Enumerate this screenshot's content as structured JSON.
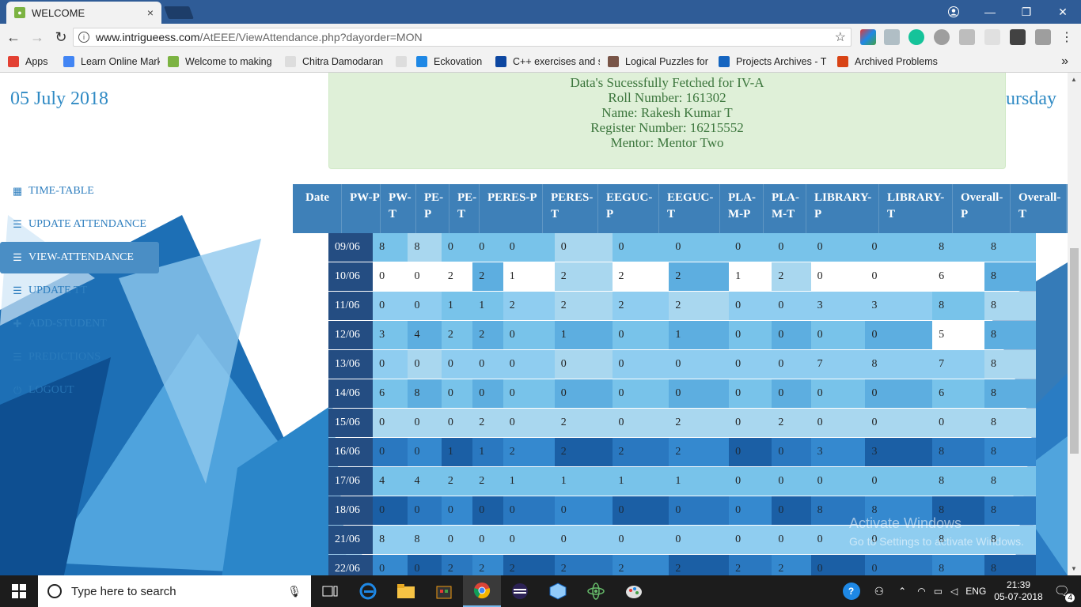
{
  "browser": {
    "tab_title": "WELCOME",
    "tab_close": "×",
    "url_host": "www.intrigueess.com",
    "url_path": "/AtEEE/ViewAttendance.php?dayorder=MON",
    "bookmarks": [
      {
        "label": "Apps",
        "color": "#e34133",
        "icon": "apps-grid-icon"
      },
      {
        "label": "Learn Online Market",
        "color": "#4285f4",
        "icon": "google-icon"
      },
      {
        "label": "Welcome to making",
        "color": "#7cb342",
        "icon": "leaf-icon"
      },
      {
        "label": "Chitra Damodaran",
        "color": "#dddddd",
        "icon": "page-icon"
      },
      {
        "label": "",
        "color": "#dddddd",
        "icon": "page-icon"
      },
      {
        "label": "Eckovation",
        "color": "#1e88e5",
        "icon": "eckovation-icon"
      },
      {
        "label": "C++ exercises and s",
        "color": "#0d47a1",
        "icon": "cpp-icon"
      },
      {
        "label": "Logical Puzzles for In",
        "color": "#795548",
        "icon": "puzzle-icon"
      },
      {
        "label": "Projects Archives - T",
        "color": "#1565c0",
        "icon": "projects-icon"
      },
      {
        "label": "Archived Problems -",
        "color": "#d84315",
        "icon": "archive-icon"
      }
    ],
    "bookmarks_more": "»"
  },
  "page": {
    "date_left": "05 July 2018",
    "day_right": "ursday",
    "alert_lines": [
      "Data's Sucessfully Fetched for IV-A",
      "Roll Number: 161302",
      "Name: Rakesh Kumar T",
      "Register Number: 16215552",
      "Mentor: Mentor Two"
    ],
    "menu": [
      {
        "label": "TIME-TABLE",
        "icon": "calendar-icon",
        "glyph": "▦",
        "active": false
      },
      {
        "label": "UPDATE ATTENDANCE",
        "icon": "list-icon",
        "glyph": "☰",
        "active": false
      },
      {
        "label": "VIEW-ATTENDANCE",
        "icon": "list-icon",
        "glyph": "☰",
        "active": true
      },
      {
        "label": "UPDATE TT",
        "icon": "list-icon",
        "glyph": "☰",
        "active": false
      },
      {
        "label": "ADD-STUDENT",
        "icon": "plus-icon",
        "glyph": "✚",
        "active": false
      },
      {
        "label": "PREDICTIONS",
        "icon": "list-icon",
        "glyph": "☰",
        "active": false
      },
      {
        "label": "LOGOUT",
        "icon": "power-icon",
        "glyph": "⏻",
        "active": false
      }
    ],
    "table": {
      "headers": [
        "Date",
        "PW-P",
        "PW-T",
        "PE-P",
        "PE-T",
        "PERES-P",
        "PERES-T",
        "EEGUC-P",
        "EEGUC-T",
        "PLA-M-P",
        "PLA-M-T",
        "LIBRARY-P",
        "LIBRARY-T",
        "Overall-P",
        "Overall-T"
      ],
      "rows": [
        {
          "date": "09/06",
          "values": [
            "8",
            "8",
            "0",
            "0",
            "0",
            "0",
            "0",
            "0",
            "0",
            "0",
            "0",
            "0",
            "8",
            "8"
          ]
        },
        {
          "date": "10/06",
          "values": [
            "0",
            "0",
            "2",
            "2",
            "1",
            "2",
            "2",
            "2",
            "1",
            "2",
            "0",
            "0",
            "6",
            "8"
          ]
        },
        {
          "date": "11/06",
          "values": [
            "0",
            "0",
            "1",
            "1",
            "2",
            "2",
            "2",
            "2",
            "0",
            "0",
            "3",
            "3",
            "8",
            "8"
          ]
        },
        {
          "date": "12/06",
          "values": [
            "3",
            "4",
            "2",
            "2",
            "0",
            "1",
            "0",
            "1",
            "0",
            "0",
            "0",
            "0",
            "5",
            "8"
          ]
        },
        {
          "date": "13/06",
          "values": [
            "0",
            "0",
            "0",
            "0",
            "0",
            "0",
            "0",
            "0",
            "0",
            "0",
            "7",
            "8",
            "7",
            "8"
          ]
        },
        {
          "date": "14/06",
          "values": [
            "6",
            "8",
            "0",
            "0",
            "0",
            "0",
            "0",
            "0",
            "0",
            "0",
            "0",
            "0",
            "6",
            "8"
          ]
        },
        {
          "date": "15/06",
          "values": [
            "0",
            "0",
            "0",
            "2",
            "0",
            "2",
            "0",
            "2",
            "0",
            "2",
            "0",
            "0",
            "0",
            "8"
          ]
        },
        {
          "date": "16/06",
          "values": [
            "0",
            "0",
            "1",
            "1",
            "2",
            "2",
            "2",
            "2",
            "0",
            "0",
            "3",
            "3",
            "8",
            "8"
          ]
        },
        {
          "date": "17/06",
          "values": [
            "4",
            "4",
            "2",
            "2",
            "1",
            "1",
            "1",
            "1",
            "0",
            "0",
            "0",
            "0",
            "8",
            "8"
          ]
        },
        {
          "date": "18/06",
          "values": [
            "0",
            "0",
            "0",
            "0",
            "0",
            "0",
            "0",
            "0",
            "0",
            "0",
            "8",
            "8",
            "8",
            "8"
          ]
        },
        {
          "date": "21/06",
          "values": [
            "8",
            "8",
            "0",
            "0",
            "0",
            "0",
            "0",
            "0",
            "0",
            "0",
            "0",
            "0",
            "8",
            "8"
          ]
        },
        {
          "date": "22/06",
          "values": [
            "0",
            "0",
            "2",
            "2",
            "2",
            "2",
            "2",
            "2",
            "2",
            "2",
            "0",
            "0",
            "8",
            "8"
          ]
        }
      ]
    },
    "watermark_title": "Activate Windows",
    "watermark_sub": "Go to Settings to activate Windows."
  },
  "taskbar": {
    "search_placeholder": "Type here to search",
    "language": "ENG",
    "time": "21:39",
    "date": "05-07-2018",
    "notification_count": "4"
  }
}
